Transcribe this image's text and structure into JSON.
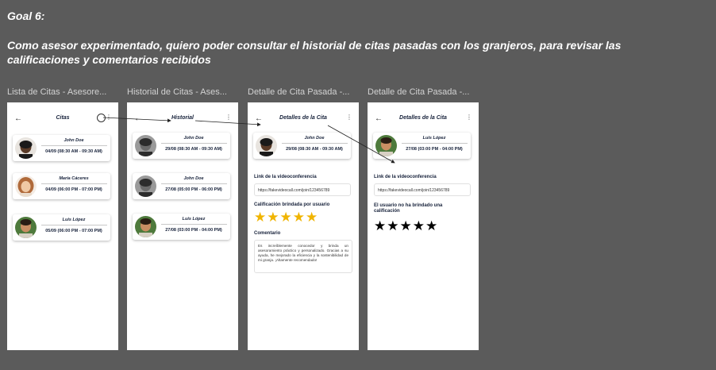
{
  "goal": "Goal 6:",
  "story": "Como asesor experimentado, quiero poder consultar el historial de citas pasadas con los granjeros, para revisar las calificaciones y comentarios recibidos",
  "frames": [
    {
      "title": "Lista de Citas - Asesore...",
      "header": "Citas",
      "cards": [
        {
          "name": "John Doe",
          "datetime": "04/09 (08:30 AM - 09:30 AM)"
        },
        {
          "name": "María Cáceres",
          "datetime": "04/09 (06:00 PM - 07:00 PM)"
        },
        {
          "name": "Luis López",
          "datetime": "05/09 (06:00 PM - 07:00 PM)"
        }
      ]
    },
    {
      "title": "Historial de Citas - Ases...",
      "header": "Historial",
      "cards": [
        {
          "name": "John Doe",
          "datetime": "29/08 (08:30 AM - 09:30 AM)"
        },
        {
          "name": "John Doe",
          "datetime": "27/08 (05:00 PM - 06:00 PM)"
        },
        {
          "name": "Luis López",
          "datetime": "27/08 (03:00 PM - 04:00 PM)"
        }
      ]
    },
    {
      "title": "Detalle de Cita Pasada -...",
      "header": "Detalles de la Cita",
      "card": {
        "name": "John Doe",
        "datetime": "29/08 (08:30 AM - 09:30 AM)"
      },
      "link_label": "Link de la videoconferencia",
      "link_value": "https://fakevideocall.com/join/123456789",
      "rating_label": "Calificación brindada por usuario",
      "rating": "★★★★★",
      "rating_value": 5,
      "comment_label": "Comentario",
      "comment": "Es increíblemente conocedor y brinda un asesoramiento práctico y personalizado. Gracias a su ayuda, he mejorado la eficiencia y la sostenibilidad de mi granja. ¡Altamente recomendado!"
    },
    {
      "title": "Detalle de Cita Pasada -...",
      "header": "Detalles de la Cita",
      "card": {
        "name": "Luis López",
        "datetime": "27/08 (03:00 PM - 04:00 PM)"
      },
      "link_label": "Link de la videoconferencia",
      "link_value": "https://fakevideocall.com/join/123456789",
      "no_rating_label": "El usuario no ha brindado una calificación",
      "rating": "★★★★★",
      "rating_value": 0
    }
  ],
  "icons": {
    "back": "arrow-left-icon",
    "menu": "kebab-menu-icon",
    "history": "history-icon",
    "rating": "star-icon"
  },
  "glyphs": {
    "back": "←",
    "menu": "⋮"
  },
  "colors": {
    "canvas": "#5b5b5b",
    "navy_text": "#16213a",
    "star_filled": "#f0b400",
    "star_empty": "#000000"
  }
}
